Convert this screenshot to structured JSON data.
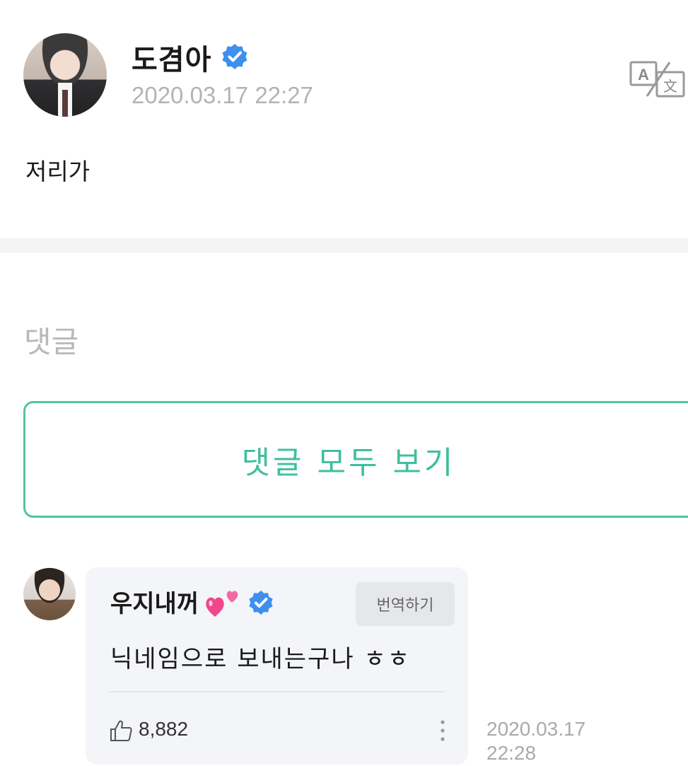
{
  "post": {
    "author": "도겸아",
    "date": "2020.03.17 22:27",
    "body": "저리가"
  },
  "comments_section": {
    "heading": "댓글",
    "view_all_label": "댓글 모두 보기"
  },
  "comment": {
    "author": "우지내꺼",
    "translate_label": "번역하기",
    "text": "닉네임으로 보내는구나 ㅎㅎ",
    "like_count": "8,882",
    "date_line1": "2020.03.17",
    "date_line2": "22:28"
  },
  "colors": {
    "accent": "#3fbf9d",
    "verified": "#3d8ff0",
    "heart": "#f0468a"
  },
  "icons": [
    "verified-badge-icon",
    "translate-icon",
    "two-hearts-icon",
    "thumbs-up-icon",
    "more-vertical-icon"
  ]
}
